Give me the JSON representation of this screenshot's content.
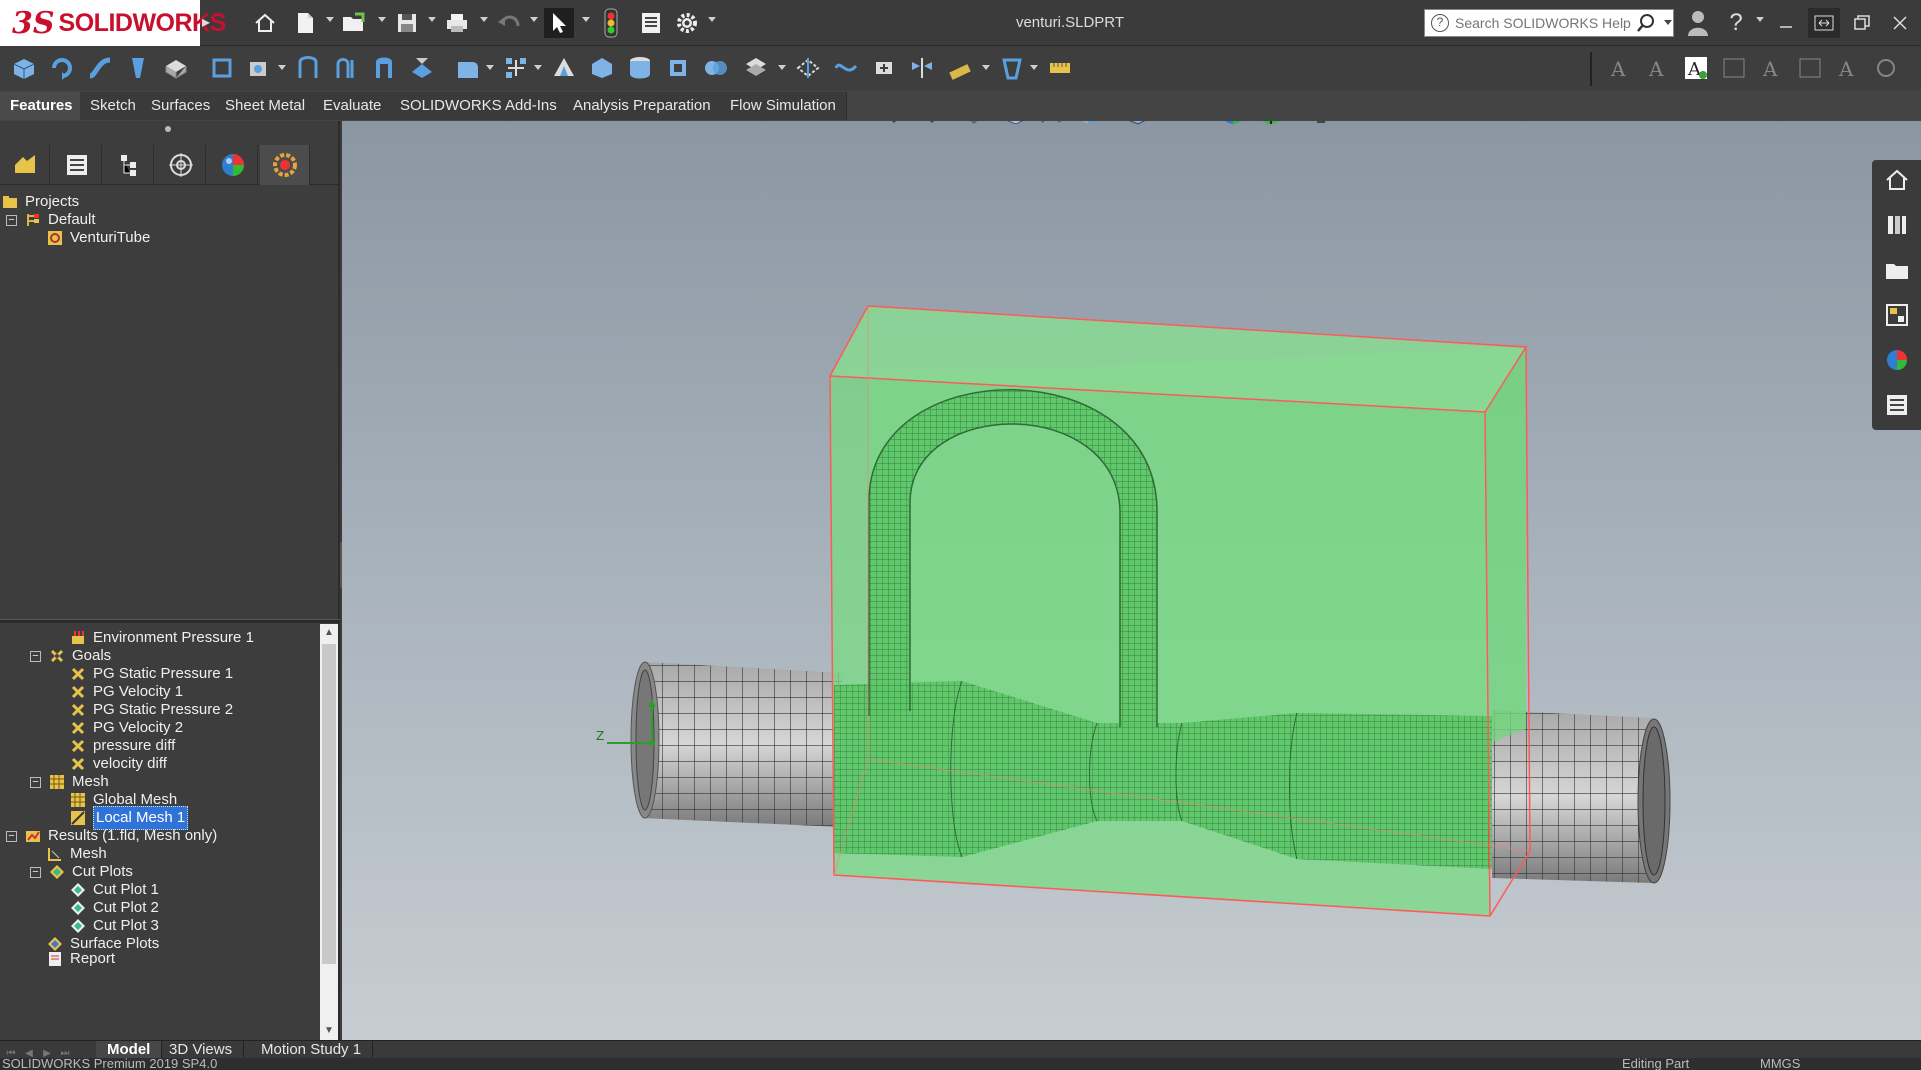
{
  "app": {
    "logo_ds": "3S",
    "logo_word": "SOLIDWORKS",
    "doc_title": "venturi.SLDPRT"
  },
  "search": {
    "placeholder": "Search SOLIDWORKS Help"
  },
  "tabs": [
    {
      "label": "Features",
      "active": true
    },
    {
      "label": "Sketch"
    },
    {
      "label": "Surfaces"
    },
    {
      "label": "Sheet Metal"
    },
    {
      "label": "Evaluate"
    },
    {
      "label": "SOLIDWORKS Add-Ins"
    },
    {
      "label": "Analysis Preparation"
    },
    {
      "label": "Flow Simulation"
    }
  ],
  "tree_top": [
    {
      "label": "Projects",
      "icon": "projects-icon"
    },
    {
      "label": "Default",
      "icon": "config-icon"
    },
    {
      "label": "VenturiTube",
      "icon": "project-gear-icon"
    }
  ],
  "tree_bottom": [
    {
      "label": "Environment Pressure 1",
      "icon": "boundary-condition-icon"
    },
    {
      "label": "Goals",
      "icon": "goals-icon"
    },
    {
      "label": "PG Static Pressure 1",
      "icon": "goal-icon"
    },
    {
      "label": "PG Velocity 1",
      "icon": "goal-icon"
    },
    {
      "label": "PG Static Pressure 2",
      "icon": "goal-icon"
    },
    {
      "label": "PG Velocity 2",
      "icon": "goal-icon"
    },
    {
      "label": "pressure diff",
      "icon": "goal-icon"
    },
    {
      "label": "velocity diff",
      "icon": "goal-icon"
    },
    {
      "label": "Mesh",
      "icon": "mesh-icon"
    },
    {
      "label": "Global Mesh",
      "icon": "global-mesh-icon"
    },
    {
      "label": "Local Mesh 1",
      "icon": "local-mesh-icon",
      "selected": true
    },
    {
      "label": "Results (1.fld, Mesh only)",
      "icon": "results-icon"
    },
    {
      "label": "Mesh",
      "icon": "result-mesh-icon"
    },
    {
      "label": "Cut Plots",
      "icon": "cut-plots-icon"
    },
    {
      "label": "Cut Plot 1",
      "icon": "cut-plot-icon"
    },
    {
      "label": "Cut Plot 2",
      "icon": "cut-plot-icon"
    },
    {
      "label": "Cut Plot 3",
      "icon": "cut-plot-icon"
    },
    {
      "label": "Surface Plots",
      "icon": "surface-plots-icon"
    },
    {
      "label": "Report",
      "icon": "report-icon"
    }
  ],
  "bottom_tabs": [
    {
      "label": "Model",
      "active": true
    },
    {
      "label": "3D Views"
    },
    {
      "label": "Motion Study 1"
    }
  ],
  "status": {
    "left": "SOLIDWORKS Premium 2019 SP4.0",
    "mode": "Editing Part",
    "units": "MMGS"
  },
  "colors": {
    "fluid_domain": "#6ee07a",
    "domain_edge": "#ff5a5a",
    "selection": "#2f73d8",
    "brand": "#c8102e"
  }
}
